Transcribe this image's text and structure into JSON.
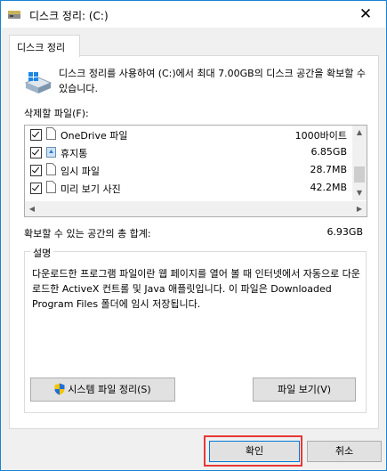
{
  "window": {
    "title": "디스크 정리: (C:)",
    "close_glyph": "✕"
  },
  "tab": {
    "label": "디스크 정리"
  },
  "intro": {
    "text": "디스크 정리를 사용하여 (C:)에서 최대 7.00GB의 디스크 공간을 확보할 수 있습니다."
  },
  "files": {
    "label": "삭제할 파일(F):",
    "rows": [
      {
        "name": "OneDrive 파일",
        "size": "1000바이트",
        "checked": true,
        "icon": "file-icon"
      },
      {
        "name": "휴지통",
        "size": "6.85GB",
        "checked": true,
        "icon": "recycle-bin-icon"
      },
      {
        "name": "임시 파일",
        "size": "28.7MB",
        "checked": true,
        "icon": "file-icon"
      },
      {
        "name": "미리 보기 사진",
        "size": "42.2MB",
        "checked": true,
        "icon": "file-icon"
      }
    ]
  },
  "total": {
    "label": "확보할 수 있는 공간의 총 합계:",
    "value": "6.93GB"
  },
  "description": {
    "legend": "설명",
    "text": "다운로드한 프로그램 파일이란 웹 페이지를 열어 볼 때 인터넷에서 자동으로 다운로드한 ActiveX 컨트롤 및 Java 애플릿입니다. 이 파일은 Downloaded Program Files 폴더에 임시 저장됩니다."
  },
  "buttons": {
    "cleanup_system": "시스템 파일 정리(S)",
    "view_files": "파일 보기(V)",
    "ok": "확인",
    "cancel": "취소"
  },
  "colors": {
    "accent": "#0078d7",
    "highlight": "#e53935"
  }
}
